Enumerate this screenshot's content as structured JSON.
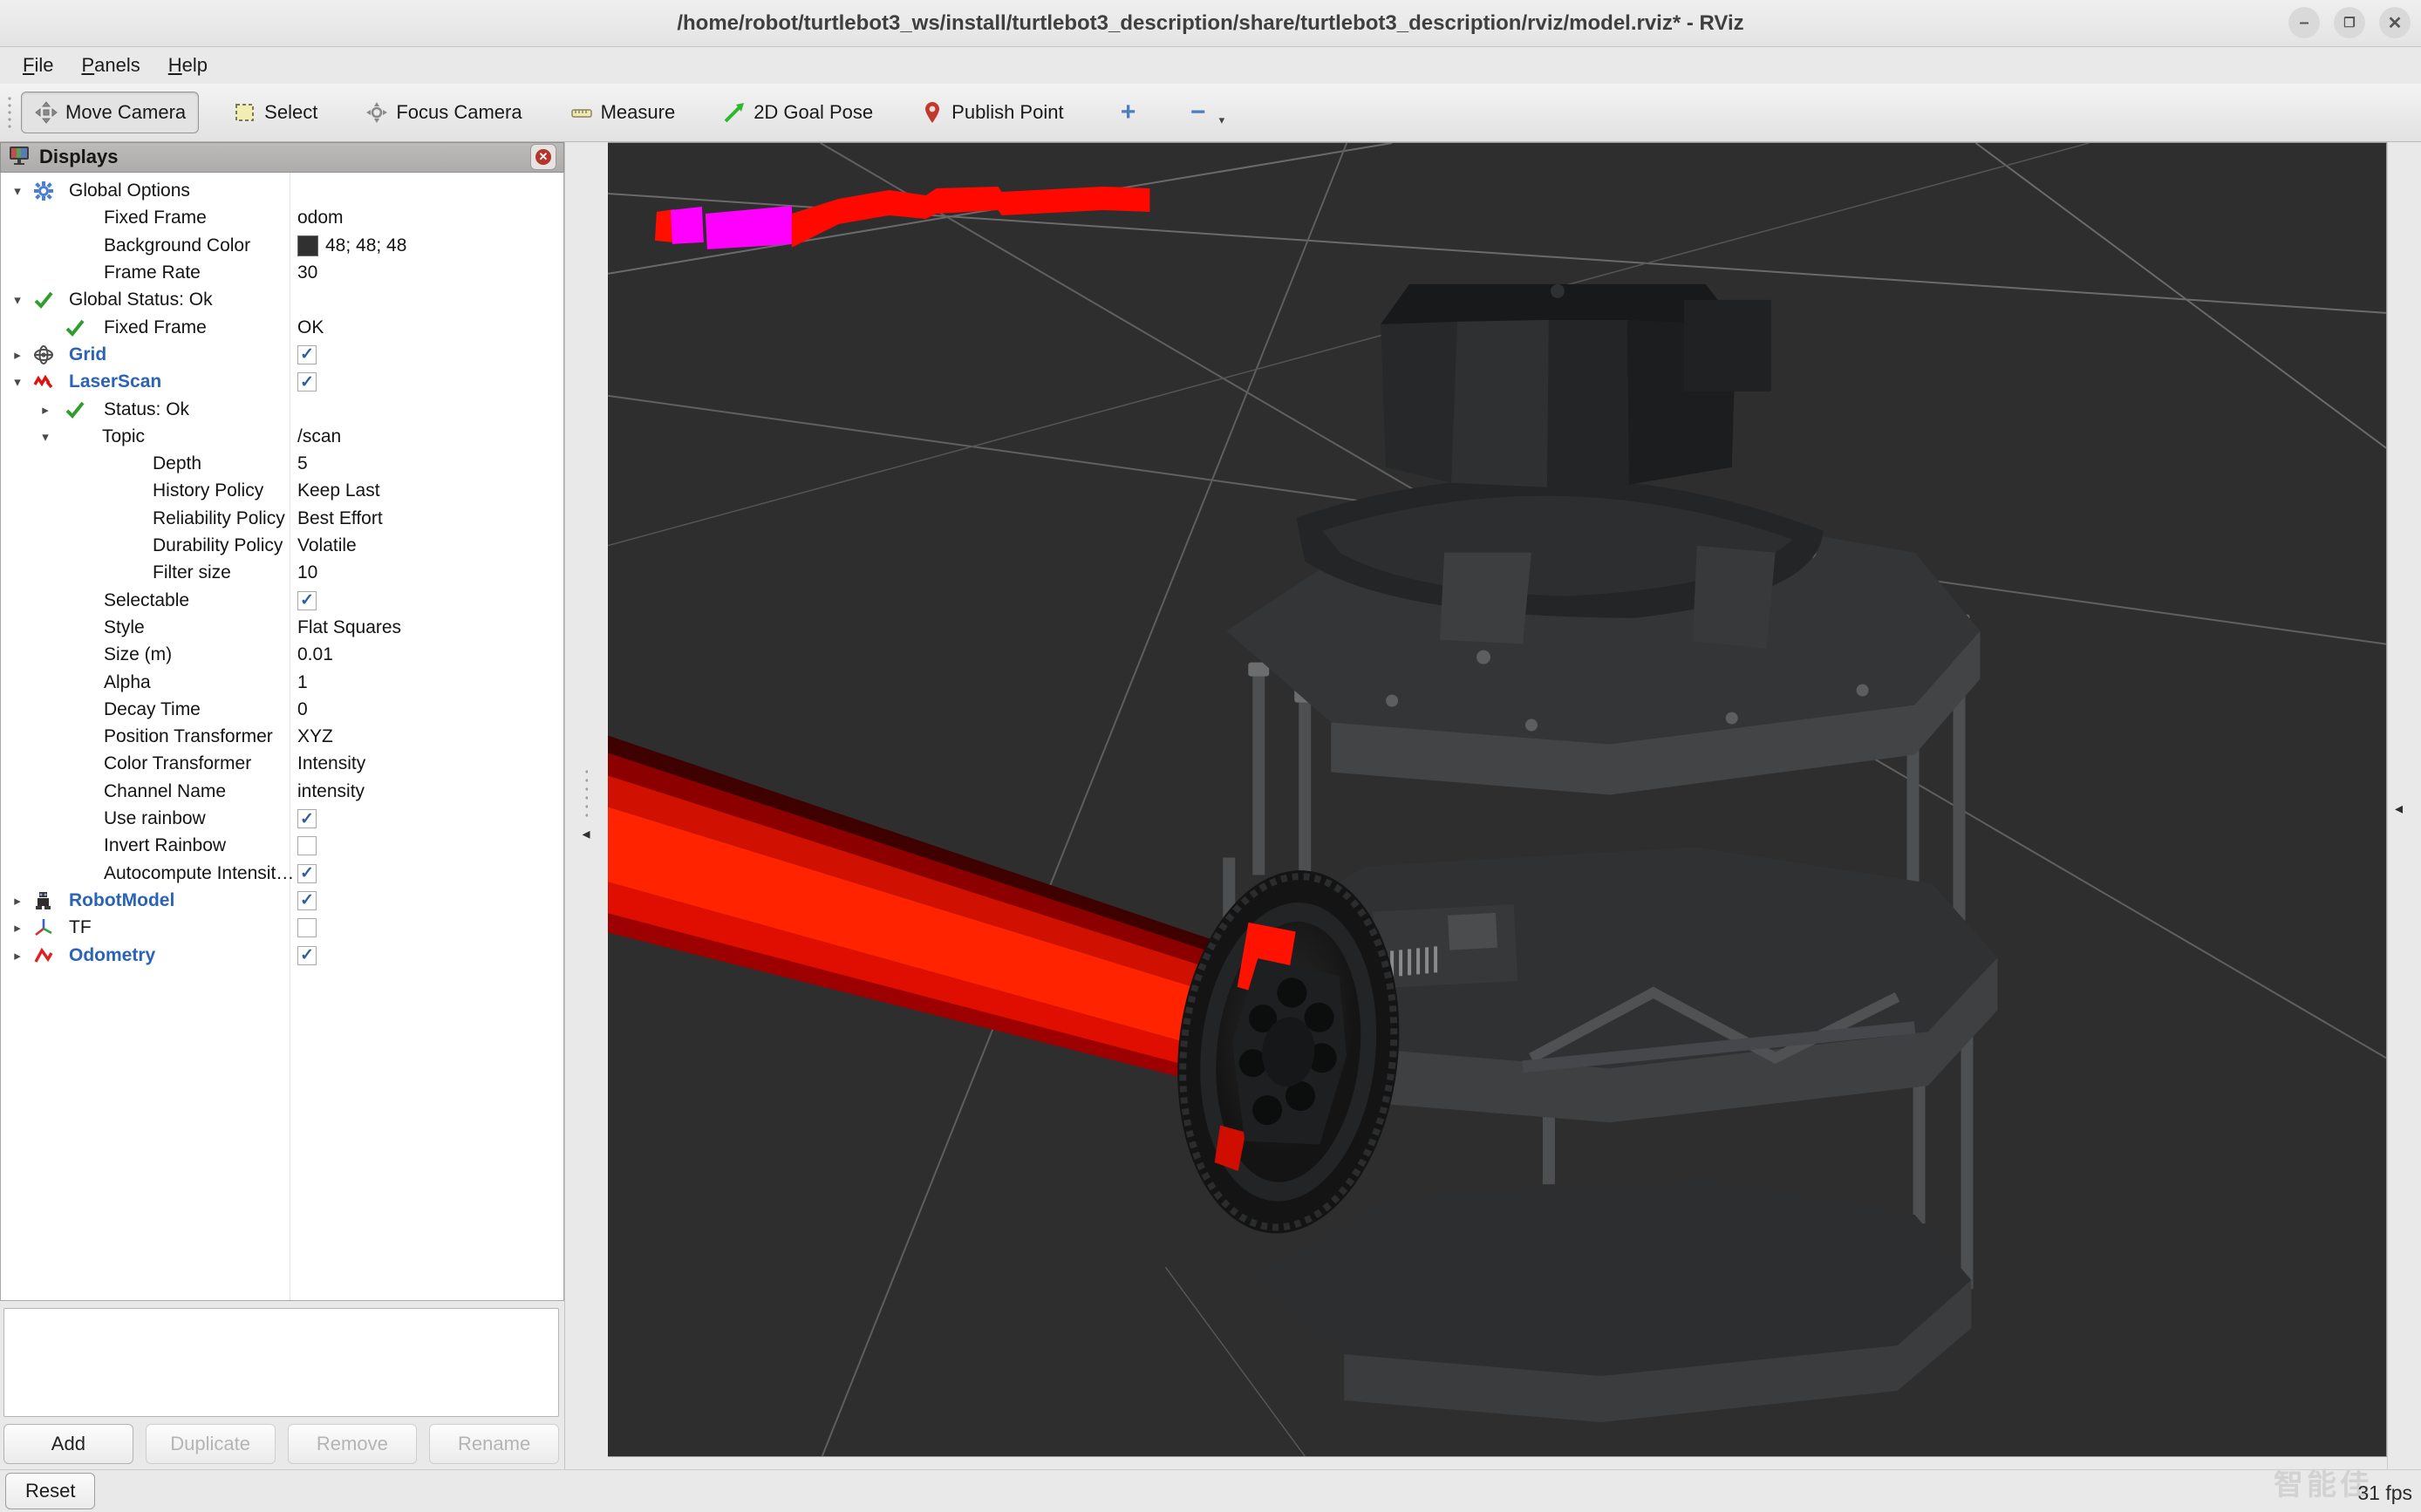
{
  "window": {
    "title": "/home/robot/turtlebot3_ws/install/turtlebot3_description/share/turtlebot3_description/rviz/model.rviz* - RViz",
    "controls": [
      {
        "name": "minimize",
        "glyph": "–"
      },
      {
        "name": "restore",
        "glyph": "❐"
      },
      {
        "name": "close",
        "glyph": "✕"
      }
    ]
  },
  "menu": {
    "items": [
      "File",
      "Panels",
      "Help"
    ]
  },
  "toolbar": {
    "tools": [
      {
        "label": "Move Camera",
        "icon": "move",
        "selected": true
      },
      {
        "label": "Select",
        "icon": "select",
        "selected": false
      },
      {
        "label": "Focus Camera",
        "icon": "focus",
        "selected": false
      },
      {
        "label": "Measure",
        "icon": "measure",
        "selected": false
      },
      {
        "label": "2D Goal Pose",
        "icon": "goal",
        "selected": false
      },
      {
        "label": "Publish Point",
        "icon": "point",
        "selected": false
      },
      {
        "label": "",
        "icon": "plus",
        "selected": false,
        "icon_only": true
      },
      {
        "label": "",
        "icon": "minus",
        "selected": false,
        "icon_only": true,
        "dropdown": true
      }
    ]
  },
  "displays_panel": {
    "title": "Displays",
    "rows": [
      {
        "indent": 0,
        "arrow": "down",
        "icon": "gear",
        "label": "Global Options",
        "value": "",
        "vtype": "none"
      },
      {
        "indent": 1,
        "arrow": null,
        "icon": null,
        "label": "Fixed Frame",
        "value": "odom",
        "vtype": "text"
      },
      {
        "indent": 1,
        "arrow": null,
        "icon": null,
        "label": "Background Color",
        "value": "48; 48; 48",
        "vtype": "color",
        "swatch": "#303030"
      },
      {
        "indent": 1,
        "arrow": null,
        "icon": null,
        "label": "Frame Rate",
        "value": "30",
        "vtype": "text"
      },
      {
        "indent": 0,
        "arrow": "down",
        "icon": "check",
        "label": "Global Status: Ok",
        "value": "",
        "vtype": "none"
      },
      {
        "indent": 1,
        "arrow": null,
        "icon": "check",
        "label": "Fixed Frame",
        "value": "OK",
        "vtype": "text"
      },
      {
        "indent": 0,
        "arrow": "right",
        "icon": "grid",
        "label": "Grid",
        "blue": true,
        "value": "",
        "vtype": "checked"
      },
      {
        "indent": 0,
        "arrow": "down",
        "icon": "laser",
        "label": "LaserScan",
        "blue": true,
        "value": "",
        "vtype": "checked"
      },
      {
        "indent": 1,
        "arrow": "right",
        "icon": "check",
        "label": "Status: Ok",
        "value": "",
        "vtype": "none"
      },
      {
        "indent": 1,
        "arrow": "down",
        "icon": null,
        "label": "Topic",
        "value": "/scan",
        "vtype": "text"
      },
      {
        "indent": 2,
        "arrow": null,
        "icon": null,
        "label": "Depth",
        "value": "5",
        "vtype": "text"
      },
      {
        "indent": 2,
        "arrow": null,
        "icon": null,
        "label": "History Policy",
        "value": "Keep Last",
        "vtype": "text"
      },
      {
        "indent": 2,
        "arrow": null,
        "icon": null,
        "label": "Reliability Policy",
        "value": "Best Effort",
        "vtype": "text"
      },
      {
        "indent": 2,
        "arrow": null,
        "icon": null,
        "label": "Durability Policy",
        "value": "Volatile",
        "vtype": "text"
      },
      {
        "indent": 2,
        "arrow": null,
        "icon": null,
        "label": "Filter size",
        "value": "10",
        "vtype": "text"
      },
      {
        "indent": 1,
        "arrow": null,
        "icon": null,
        "label": "Selectable",
        "value": "",
        "vtype": "checked"
      },
      {
        "indent": 1,
        "arrow": null,
        "icon": null,
        "label": "Style",
        "value": "Flat Squares",
        "vtype": "text"
      },
      {
        "indent": 1,
        "arrow": null,
        "icon": null,
        "label": "Size (m)",
        "value": "0.01",
        "vtype": "text"
      },
      {
        "indent": 1,
        "arrow": null,
        "icon": null,
        "label": "Alpha",
        "value": "1",
        "vtype": "text"
      },
      {
        "indent": 1,
        "arrow": null,
        "icon": null,
        "label": "Decay Time",
        "value": "0",
        "vtype": "text"
      },
      {
        "indent": 1,
        "arrow": null,
        "icon": null,
        "label": "Position Transformer",
        "value": "XYZ",
        "vtype": "text"
      },
      {
        "indent": 1,
        "arrow": null,
        "icon": null,
        "label": "Color Transformer",
        "value": "Intensity",
        "vtype": "text"
      },
      {
        "indent": 1,
        "arrow": null,
        "icon": null,
        "label": "Channel Name",
        "value": "intensity",
        "vtype": "text"
      },
      {
        "indent": 1,
        "arrow": null,
        "icon": null,
        "label": "Use rainbow",
        "value": "",
        "vtype": "checked"
      },
      {
        "indent": 1,
        "arrow": null,
        "icon": null,
        "label": "Invert Rainbow",
        "value": "",
        "vtype": "unchecked"
      },
      {
        "indent": 1,
        "arrow": null,
        "icon": null,
        "label": "Autocompute Intensit…",
        "value": "",
        "vtype": "checked"
      },
      {
        "indent": 0,
        "arrow": "right",
        "icon": "robot",
        "label": "RobotModel",
        "blue": true,
        "value": "",
        "vtype": "checked"
      },
      {
        "indent": 0,
        "arrow": "right",
        "icon": "tf",
        "label": "TF",
        "value": "",
        "vtype": "unchecked"
      },
      {
        "indent": 0,
        "arrow": "right",
        "icon": "odom",
        "label": "Odometry",
        "blue": true,
        "value": "",
        "vtype": "checked"
      }
    ],
    "buttons": [
      {
        "label": "Add",
        "enabled": true
      },
      {
        "label": "Duplicate",
        "enabled": false
      },
      {
        "label": "Remove",
        "enabled": false
      },
      {
        "label": "Rename",
        "enabled": false
      }
    ]
  },
  "statusbar": {
    "reset_label": "Reset",
    "fps": "31 fps",
    "watermark": "智能佳"
  },
  "viewport": {
    "background_color": "#2e2e2e",
    "grid_line_color": "#6a6a6a",
    "laser_scan_color": "#ff1200",
    "laser_intensity_color": "#ff00ff",
    "fixed_frame": "odom",
    "scene": "TurtleBot3 burger robot model with LDS lidar on top, left wheel visible, red laser scan beam entering from left, red/magenta scan hits strip in upper left"
  }
}
